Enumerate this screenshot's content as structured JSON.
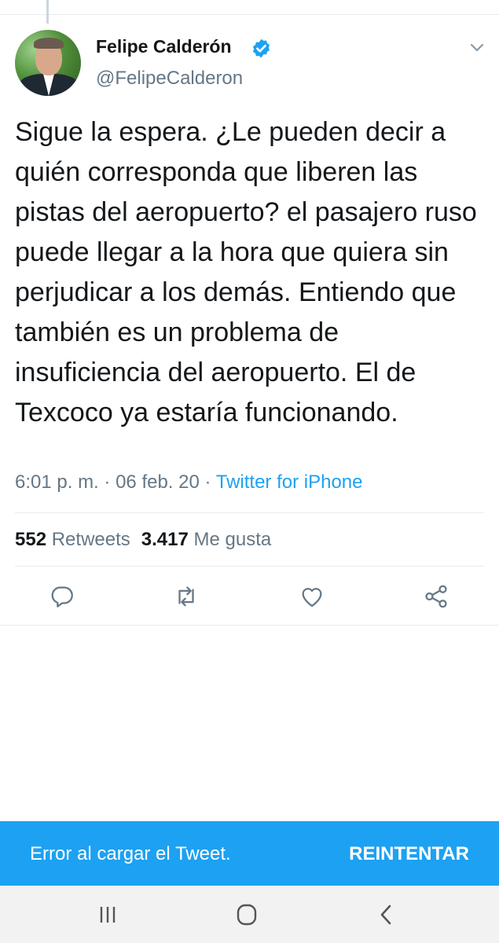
{
  "tweet": {
    "author_name": "Felipe Calderón",
    "handle": "@FelipeCalderon",
    "text": "Sigue la espera. ¿Le pueden decir a quién corresponda que liberen las pistas del aeropuerto? el pasajero ruso puede llegar a la hora que quiera sin perjudicar a los demás. Entiendo que también es un problema de insuficiencia del aeropuerto. El de Texcoco ya estaría funcionando.",
    "time": "6:01 p. m.",
    "separator": "·",
    "date": "06 feb. 20",
    "source": "Twitter for iPhone",
    "retweet_count": "552",
    "retweet_label": "Retweets",
    "like_count": "3.417",
    "like_label": "Me gusta"
  },
  "actions": {
    "reply_icon": "reply-icon",
    "retweet_icon": "retweet-icon",
    "like_icon": "heart-icon",
    "share_icon": "share-icon"
  },
  "error_bar": {
    "message": "Error al cargar el Tweet.",
    "retry_label": "REINTENTAR"
  },
  "colors": {
    "accent": "#1da1f2",
    "text": "#14171a",
    "secondary": "#657786",
    "verified": "#1da1f2"
  }
}
